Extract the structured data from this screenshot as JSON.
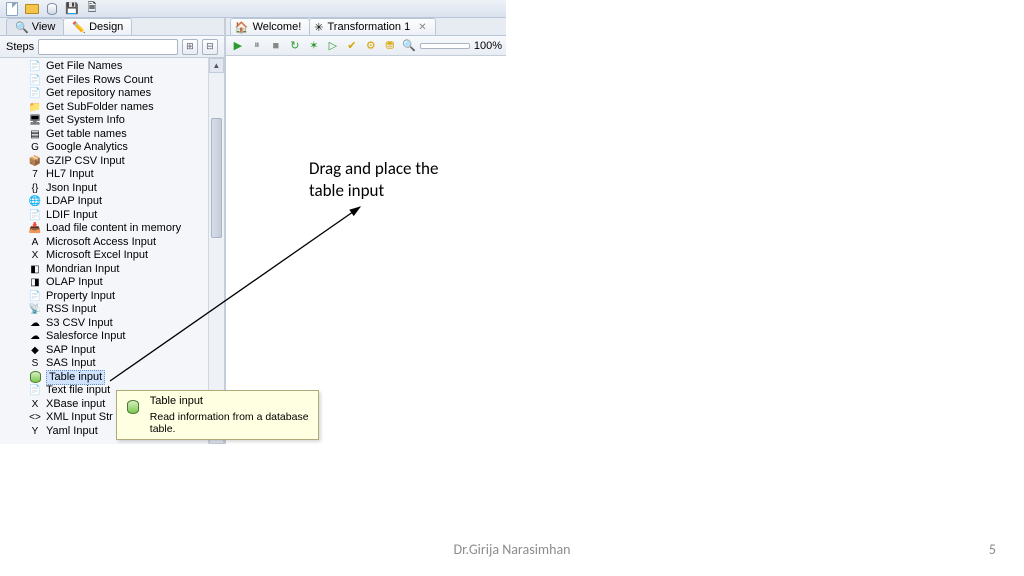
{
  "toolbar_top": {
    "buttons": [
      "new",
      "open",
      "table",
      "save",
      "saveall"
    ]
  },
  "left_tabs": {
    "view": "View",
    "design": "Design"
  },
  "steps": {
    "label": "Steps",
    "items": [
      {
        "label": "Get File Names",
        "icon": "📄",
        "sel": false
      },
      {
        "label": "Get Files Rows Count",
        "icon": "📄",
        "sel": false
      },
      {
        "label": "Get repository names",
        "icon": "📄",
        "sel": false
      },
      {
        "label": "Get SubFolder names",
        "icon": "📁",
        "sel": false
      },
      {
        "label": "Get System Info",
        "icon": "🖥",
        "sel": false
      },
      {
        "label": "Get table names",
        "icon": "▤",
        "sel": false
      },
      {
        "label": "Google Analytics",
        "icon": "G",
        "sel": false
      },
      {
        "label": "GZIP CSV Input",
        "icon": "📦",
        "sel": false
      },
      {
        "label": "HL7 Input",
        "icon": "7",
        "sel": false
      },
      {
        "label": "Json Input",
        "icon": "{}",
        "sel": false
      },
      {
        "label": "LDAP Input",
        "icon": "🌐",
        "sel": false
      },
      {
        "label": "LDIF Input",
        "icon": "📄",
        "sel": false
      },
      {
        "label": "Load file content in memory",
        "icon": "📥",
        "sel": false
      },
      {
        "label": "Microsoft Access Input",
        "icon": "A",
        "sel": false
      },
      {
        "label": "Microsoft Excel Input",
        "icon": "X",
        "sel": false
      },
      {
        "label": "Mondrian Input",
        "icon": "◧",
        "sel": false
      },
      {
        "label": "OLAP Input",
        "icon": "◨",
        "sel": false
      },
      {
        "label": "Property Input",
        "icon": "📄",
        "sel": false
      },
      {
        "label": "RSS Input",
        "icon": "📡",
        "sel": false
      },
      {
        "label": "S3 CSV Input",
        "icon": "☁",
        "sel": false
      },
      {
        "label": "Salesforce Input",
        "icon": "☁",
        "sel": false
      },
      {
        "label": "SAP Input",
        "icon": "◆",
        "sel": false
      },
      {
        "label": "SAS Input",
        "icon": "S",
        "sel": false
      },
      {
        "label": "Table input",
        "icon": "db",
        "sel": true
      },
      {
        "label": "Text file input",
        "icon": "📄",
        "sel": false
      },
      {
        "label": "XBase input",
        "icon": "X",
        "sel": false
      },
      {
        "label": "XML Input Str",
        "icon": "<>",
        "sel": false
      },
      {
        "label": "Yaml Input",
        "icon": "Y",
        "sel": false
      }
    ]
  },
  "editor_tabs": {
    "welcome": "Welcome!",
    "transf": "Transformation 1"
  },
  "runbar": {
    "zoom": "100%"
  },
  "tooltip": {
    "title": "Table input",
    "desc": "Read information from a database table."
  },
  "annotation": {
    "line1": "Drag and place the",
    "line2": "table input"
  },
  "footer": {
    "author": "Dr.Girija Narasimhan",
    "page": "5"
  }
}
